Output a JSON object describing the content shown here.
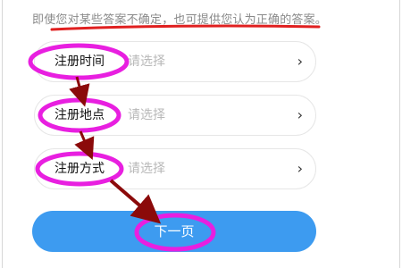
{
  "notice": "即使您对某些答案不确定，也可提供您认为正确的答案。",
  "fields": [
    {
      "label": "注册时间",
      "placeholder": "请选择",
      "chevron": "›"
    },
    {
      "label": "注册地点",
      "placeholder": "请选择",
      "chevron": "›"
    },
    {
      "label": "注册方式",
      "placeholder": "请选择",
      "chevron": "›"
    }
  ],
  "next_button": "下一页",
  "annotation_colors": {
    "underline": "#e02020",
    "ellipse": "#e81fe0",
    "arrow": "#8b0a0a"
  }
}
